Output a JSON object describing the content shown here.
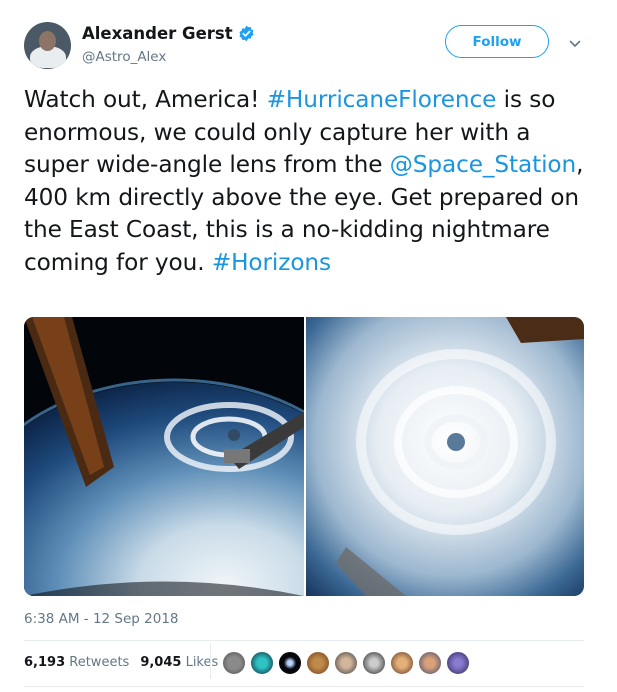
{
  "author": {
    "name": "Alexander Gerst",
    "handle": "@Astro_Alex",
    "verified": true,
    "avatar_icon": "astronaut-avatar"
  },
  "follow_label": "Follow",
  "menu_icon": "chevron-down-icon",
  "tweet": {
    "segments": [
      {
        "text": "Watch out, America! ",
        "link": false
      },
      {
        "text": "#HurricaneFlorence",
        "link": true
      },
      {
        "text": " is so enormous, we could only capture her with a super wide-angle lens from the ",
        "link": false
      },
      {
        "text": "@Space_Station",
        "link": true
      },
      {
        "text": ", 400 km directly above the eye. Get prepared on the East Coast, this is a no-kidding nightmare coming for you. ",
        "link": false
      },
      {
        "text": "#Horizons",
        "link": true
      }
    ]
  },
  "media": {
    "photos": [
      {
        "name": "hurricane-from-iss-wide-angle"
      },
      {
        "name": "hurricane-eye-close-up"
      }
    ]
  },
  "timestamp": "6:38 AM - 12 Sep 2018",
  "stats": {
    "retweets_count": "6,193",
    "retweets_label": "Retweets",
    "likes_count": "9,045",
    "likes_label": "Likes"
  },
  "liker_avatars_count": 9,
  "colors": {
    "link": "#1b95e0",
    "accent": "#1da1f2",
    "muted": "#657786",
    "text": "#14171a",
    "divider": "#e6ecf0"
  }
}
